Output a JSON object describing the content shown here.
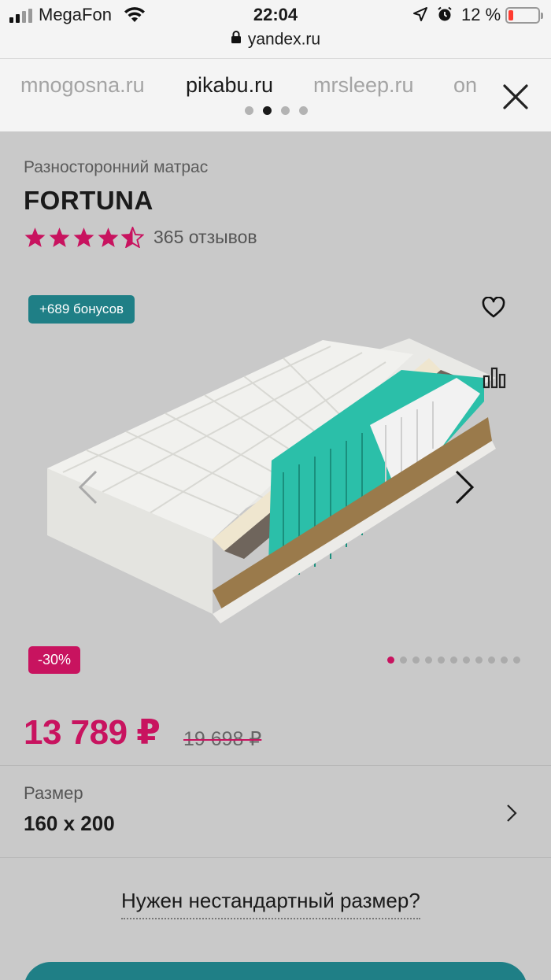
{
  "status_bar": {
    "carrier": "MegaFon",
    "time": "22:04",
    "battery": "12 %",
    "battery_level": 0.12
  },
  "browser": {
    "url": "yandex.ru",
    "tabs": [
      {
        "label": "mnogosna.ru",
        "active": false
      },
      {
        "label": "pikabu.ru",
        "active": true
      },
      {
        "label": "mrsleep.ru",
        "active": false
      },
      {
        "label": "on",
        "active": false
      }
    ],
    "page_dots": 4,
    "active_dot": 1
  },
  "product": {
    "subtitle": "Разносторонний матрас",
    "title": "FORTUNA",
    "rating": 4.5,
    "reviews": "365 отзывов",
    "bonus_badge": "+689 бонусов",
    "discount_badge": "-30%",
    "gallery_count": 11,
    "gallery_active": 0,
    "price": "13 789 ₽",
    "old_price": "19 698 ₽"
  },
  "size": {
    "label": "Размер",
    "value": "160 x 200"
  },
  "custom_size_link": "Нужен нестандартный размер?",
  "colors": {
    "accent_pink": "#c8135f",
    "accent_teal": "#1f7f86"
  },
  "icons": [
    "wifi-icon",
    "location-arrow-icon",
    "alarm-icon",
    "lock-icon",
    "close-icon",
    "heart-icon",
    "compare-icon",
    "chevron-left-icon",
    "chevron-right-icon",
    "star-icon"
  ]
}
